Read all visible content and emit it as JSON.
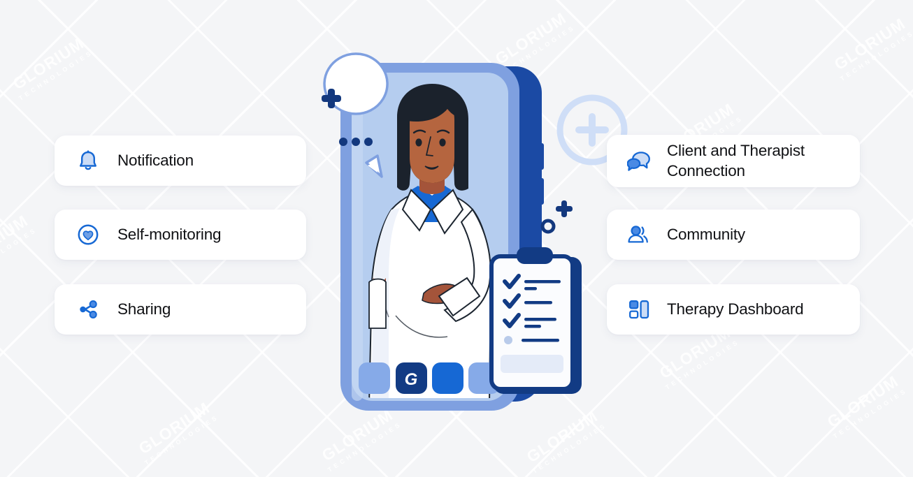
{
  "page": {
    "background_color": "#f4f5f7",
    "watermark": {
      "main": "GLORIUM",
      "sub": "TECHNOLOGIES"
    }
  },
  "colors": {
    "accent_blue": "#1668d4",
    "deep_navy": "#13387e",
    "mid_blue": "#2a6fd6",
    "light_blue": "#a9c6ef",
    "pale_blue": "#d7e4f8",
    "card_bg": "#ffffff",
    "text": "#101114"
  },
  "features": {
    "left": [
      {
        "id": "notification",
        "label": "Notification",
        "icon": "bell-icon"
      },
      {
        "id": "self-monitoring",
        "label": "Self-monitoring",
        "icon": "heart-circle-icon"
      },
      {
        "id": "sharing",
        "label": "Sharing",
        "icon": "share-nodes-icon"
      }
    ],
    "right": [
      {
        "id": "connection",
        "label": "Client and Therapist\nConnection",
        "label_line1": "Client and Therapist",
        "label_line2": "Connection",
        "icon": "chat-bubbles-icon"
      },
      {
        "id": "community",
        "label": "Community",
        "icon": "people-icon"
      },
      {
        "id": "dashboard",
        "label": "Therapy Dashboard",
        "icon": "dashboard-layout-icon"
      }
    ]
  },
  "illustration": {
    "name": "therapist-phone-illustration",
    "phone": {
      "frame_color": "#7fa0e0",
      "screen_color": "#b5cdef",
      "side_color": "#1b4aa4",
      "dock_icons": [
        {
          "name": "dock-app-1",
          "color": "#86aae8",
          "glyph": ""
        },
        {
          "name": "dock-app-glorium",
          "color": "#123b84",
          "glyph": "G"
        },
        {
          "name": "dock-app-3",
          "color": "#1668d4",
          "glyph": ""
        },
        {
          "name": "dock-app-4",
          "color": "#86aae8",
          "glyph": ""
        }
      ]
    },
    "speech_bubble": {
      "name": "typing-bubble",
      "dots": 3
    },
    "clipboard": {
      "name": "checklist-clipboard",
      "checked_items": 3,
      "unchecked_items": 1
    },
    "decorations": [
      {
        "name": "plus-mark-left",
        "color": "#13387e"
      },
      {
        "name": "circle-plus-large",
        "color": "#cfdef7"
      },
      {
        "name": "plus-mark-right",
        "color": "#13387e"
      },
      {
        "name": "ring-mark-right",
        "color": "#13387e"
      }
    ]
  }
}
